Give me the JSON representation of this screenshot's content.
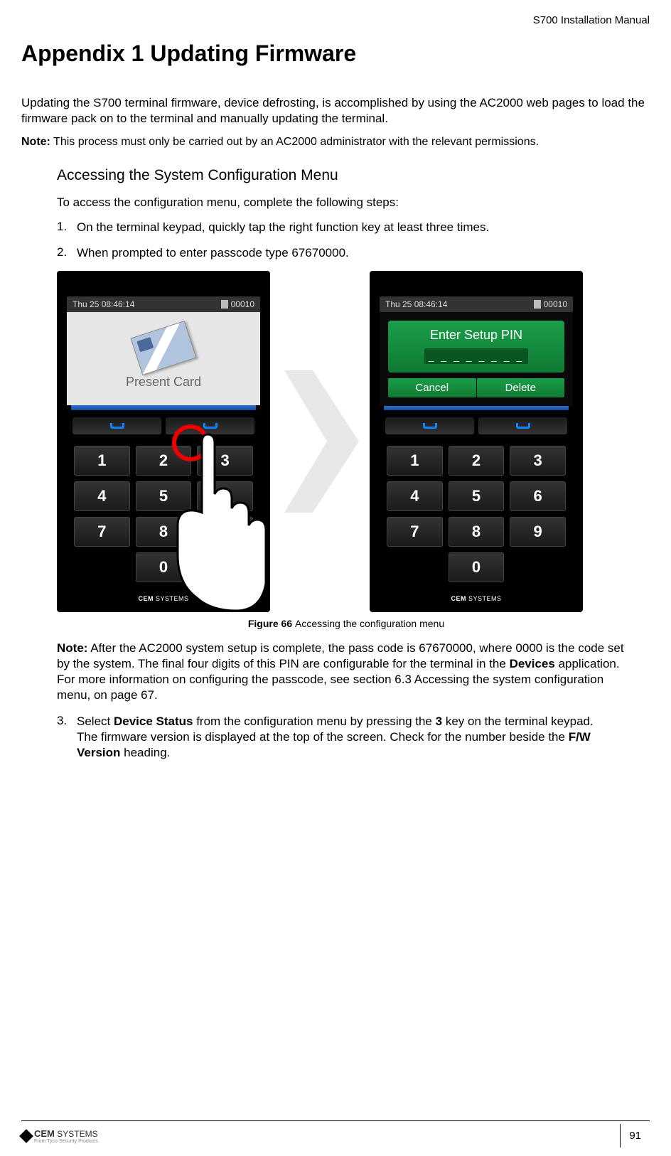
{
  "header": {
    "manual_title": "S700 Installation Manual"
  },
  "title": "Appendix 1 Updating Firmware",
  "intro": "Updating the S700 terminal firmware, device defrosting, is accomplished by using the AC2000 web pages to load the firmware pack on to the terminal and manually updating the terminal.",
  "top_note": {
    "label": "Note:",
    "text": " This process must only be carried out by an AC2000 administrator with the relevant permissions."
  },
  "section_title": "Accessing the System Configuration Menu",
  "step_intro": "To access the configuration menu, complete the following steps:",
  "steps": {
    "s1n": "1.",
    "s1t": "On the terminal keypad, quickly tap the right function key at least three times.",
    "s2n": "2.",
    "s2t": "When prompted to enter passcode type 67670000.",
    "s3n": "3.",
    "s3t_a": "Select ",
    "s3t_b": "Device Status",
    "s3t_c": " from the configuration menu by pressing the ",
    "s3t_d": "3",
    "s3t_e": " key on the terminal keypad.",
    "s3_line2a": "The firmware version is displayed at the top of the screen. Check for the number beside the ",
    "s3_line2b": "F/W Version",
    "s3_line2c": " heading."
  },
  "terminal": {
    "status_time": "Thu 25   08:46:14",
    "status_id": "00010",
    "present_card": "Present Card",
    "keys": {
      "k1": "1",
      "k2": "2",
      "k3": "3",
      "k4": "4",
      "k5": "5",
      "k6": "6",
      "k7": "7",
      "k8": "8",
      "k9": "9",
      "k0": "0"
    },
    "brand_b": "CEM",
    "brand_s": " SYSTEMS",
    "pin_title": "Enter Setup PIN",
    "pin_mask": "_ _ _ _ _ _ _ _",
    "cancel": "Cancel",
    "delete": "Delete"
  },
  "figure": {
    "label": "Figure 66 ",
    "caption": "Accessing the configuration menu"
  },
  "note2": {
    "label": "Note:",
    "t1": " After the AC2000 system setup is complete, the pass code is 67670000, where 0000 is the code set by the system. The final four digits of this PIN are configurable for the terminal in the ",
    "b1": "Devices",
    "t2": " application. For more information on configuring the passcode, see section 6.3 Accessing the system configuration menu, on page 67."
  },
  "footer": {
    "brand_b": "CEM",
    "brand_s": "SYSTEMS",
    "sub": "From Tyco Security Products",
    "page": "91"
  }
}
